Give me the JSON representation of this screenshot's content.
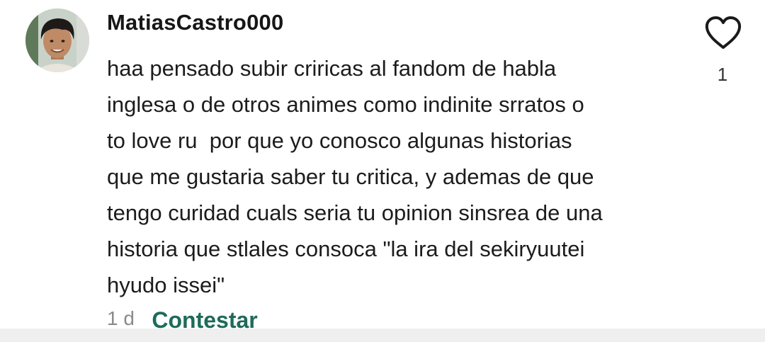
{
  "comment": {
    "username": "MatiasCastro000",
    "text_lines": [
      "haa pensado subir criricas al fandom de habla",
      "inglesa o de otros animes como indinite srratos o",
      "to love ru  por que yo conosco algunas historias",
      "que me gustaria saber tu critica, y ademas de que",
      "tengo curidad cuals seria tu opinion sinsrea de una",
      "historia que stlales consoca \"la ira del sekiryuutei",
      "hyudo issei\""
    ],
    "time": "1 d",
    "reply_label": "Contestar",
    "like_count": "1",
    "like_icon": "heart-outline-icon"
  },
  "colors": {
    "reply": "#1e6b5a",
    "text": "#1c1c1c",
    "muted": "#8a8a8a",
    "bottom_bar": "#efefef"
  }
}
